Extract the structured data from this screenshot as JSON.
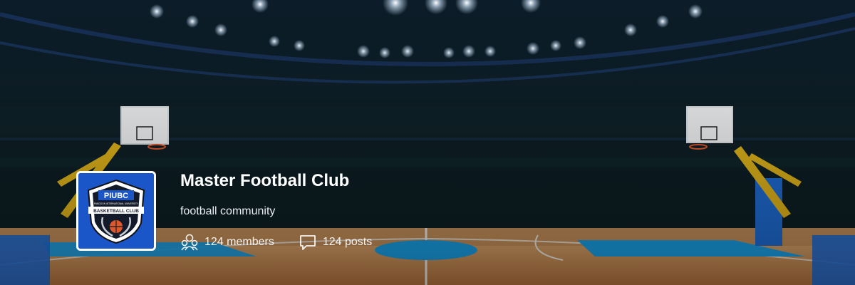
{
  "community": {
    "name": "Master Football Club",
    "description": "football community",
    "members_label": "124 members",
    "posts_label": "124 posts"
  },
  "logo": {
    "top_text": "PIUBC",
    "small_text": "PANGOON INTERNATIONAL UNIVERSITY",
    "banner_text": "BASKETBALL CLUB"
  },
  "icons": {
    "members": "members-icon",
    "posts": "chat-bubble-icon"
  },
  "colors": {
    "court_blue": "#1aa0e6",
    "wood": "#c98a4b",
    "hoop_support": "#e2b51a",
    "logo_blue": "#1a56c8"
  }
}
